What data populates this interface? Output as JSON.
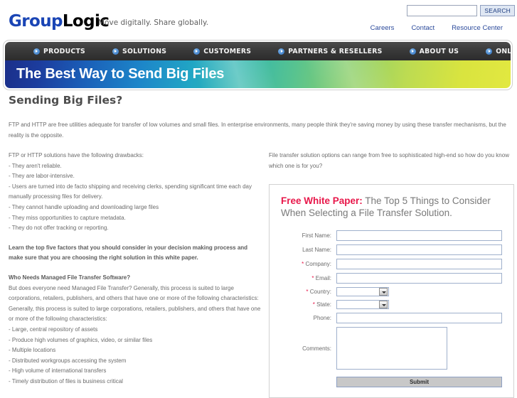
{
  "header": {
    "logo": {
      "part1": "Group",
      "part2": "Logic"
    },
    "tagline": "Move digitally. Share globally.",
    "search": {
      "value": "",
      "placeholder": "",
      "button_label": "SEARCH"
    },
    "top_links": [
      {
        "label": "Careers"
      },
      {
        "label": "Contact"
      },
      {
        "label": "Resource Center"
      }
    ]
  },
  "nav": {
    "items": [
      {
        "label": "PRODUCTS",
        "icon": "play-circle-icon"
      },
      {
        "label": "SOLUTIONS",
        "icon": "play-circle-icon"
      },
      {
        "label": "CUSTOMERS",
        "icon": "play-circle-icon"
      },
      {
        "label": "PARTNERS & RESELLERS",
        "icon": "play-circle-icon"
      },
      {
        "label": "ABOUT US",
        "icon": "play-circle-icon"
      },
      {
        "label": "ONLINE STORE",
        "icon": "play-circle-icon"
      }
    ]
  },
  "banner": {
    "title": "The Best Way to Send Big Files"
  },
  "main": {
    "page_title": "Sending Big Files?",
    "intro": "FTP and HTTP are free utilities adequate for transfer of low volumes and small files. In enterprise environments, many people think they're saving money by using these transfer mechanisms, but the reality is the opposite.",
    "left": {
      "drawbacks_intro": "FTP or HTTP solutions have the following drawbacks:",
      "drawbacks": [
        "- They aren't reliable.",
        "- They are labor-intensive.",
        "- Users are turned into de facto shipping and receiving clerks, spending significant time each day manually processing files for delivery.",
        "- They cannot handle uploading and downloading large files",
        "- They miss opportunities to capture metadata.",
        "- They do not offer tracking or reporting."
      ],
      "learn_more": "Learn the top five factors that you should consider in your decision making process and make sure that you are choosing the right solution in this white paper.",
      "subhead": "Who Needs Managed File Transfer Software?",
      "para1": "But does everyone need Managed File Transfer? Generally, this process is suited to large corporations, retailers, publishers, and others that have one or more of the following characteristics:",
      "para2": "Generally, this process is suited to large corporations, retailers, publishers, and others that have one or more of the following characteristics:",
      "characteristics": [
        "- Large, central repository of assets",
        "- Produce high volumes of graphics, video, or similar files",
        "- Multiple locations",
        "- Distributed workgroups accessing the system",
        "- High volume of international transfers",
        "- Timely distribution of files is business critical"
      ]
    },
    "right": {
      "intro": "File transfer solution options can range from free to sophisticated high-end so how do you know which one is for you?"
    }
  },
  "form": {
    "headline_highlight": "Free White Paper:",
    "headline_rest": " The Top 5 Things to Consider When Selecting a File Transfer Solution.",
    "fields": [
      {
        "label": "First Name:",
        "required": false,
        "type": "text",
        "value": ""
      },
      {
        "label": "Last Name:",
        "required": false,
        "type": "text",
        "value": ""
      },
      {
        "label": "Company:",
        "required": true,
        "type": "text",
        "value": ""
      },
      {
        "label": "Email:",
        "required": true,
        "type": "text",
        "value": ""
      },
      {
        "label": "Country:",
        "required": true,
        "type": "select",
        "value": ""
      },
      {
        "label": "State:",
        "required": true,
        "type": "select",
        "value": ""
      },
      {
        "label": "Phone:",
        "required": false,
        "type": "text",
        "value": ""
      }
    ],
    "comments_label": "Comments:",
    "comments_value": "",
    "submit_label": "Submit",
    "accent_color": "#e8174a"
  }
}
